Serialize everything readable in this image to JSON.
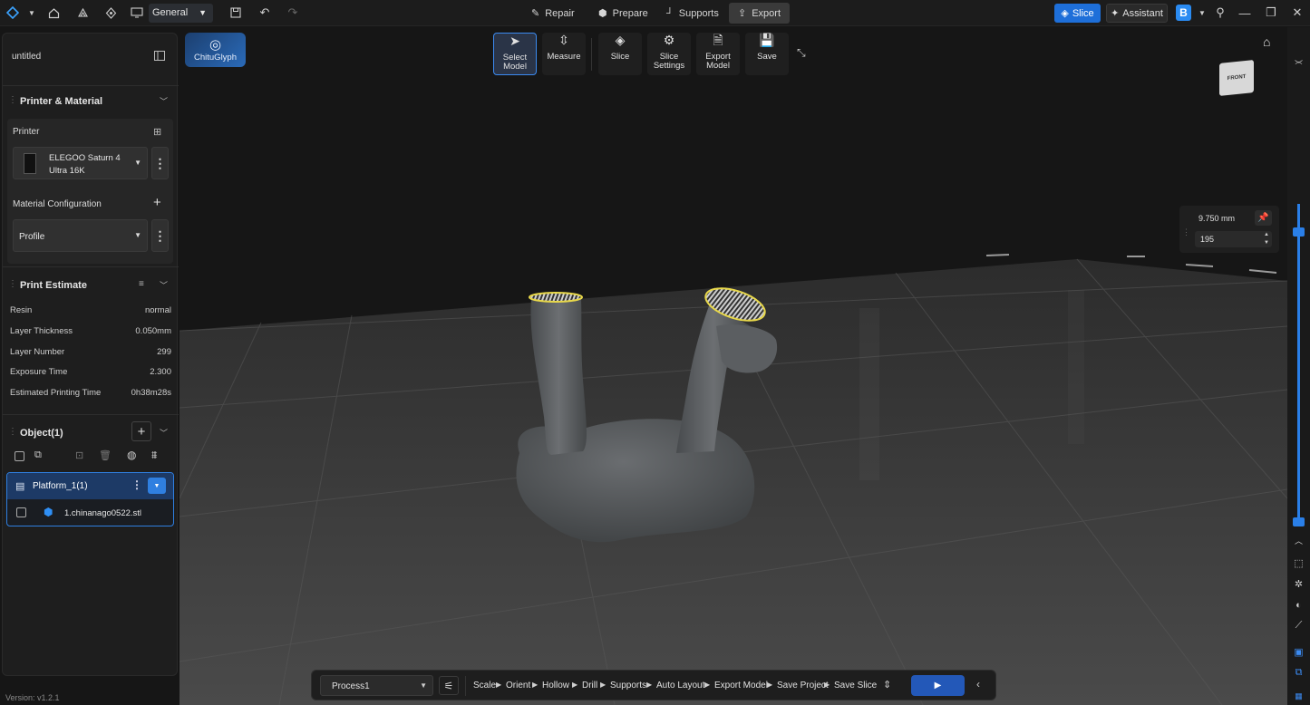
{
  "topbar": {
    "workspace": "General",
    "modes": [
      {
        "label": "Repair",
        "icon": "repair-icon"
      },
      {
        "label": "Prepare",
        "icon": "prepare-icon"
      },
      {
        "label": "Supports",
        "icon": "supports-icon"
      },
      {
        "label": "Export",
        "icon": "export-icon",
        "active": true
      }
    ],
    "slice_label": "Slice",
    "assistant_label": "Assistant",
    "profile_letter": "B"
  },
  "left_panel": {
    "project_name": "untitled",
    "printer_material": {
      "title": "Printer & Material",
      "printer_label": "Printer",
      "printer_name": "ELEGOO Saturn 4 Ultra 16K",
      "material_label": "Material Configuration",
      "profile": "Profile"
    },
    "print_estimate": {
      "title": "Print Estimate",
      "rows": [
        {
          "label": "Resin",
          "value": "normal"
        },
        {
          "label": "Layer Thickness",
          "value": "0.050mm"
        },
        {
          "label": "Layer Number",
          "value": "299"
        },
        {
          "label": "Exposure Time",
          "value": "2.300"
        },
        {
          "label": "Estimated Printing Time",
          "value": "0h38m28s"
        }
      ]
    },
    "objects": {
      "title": "Object(1)",
      "platform": "Platform_1(1)",
      "file": "1.chinanago0522.stl"
    },
    "version": "Version: v1.2.1"
  },
  "viewport": {
    "chitu_label": "ChituGlyph",
    "tools": [
      {
        "label": "Select Model",
        "active": true
      },
      {
        "label": "Measure"
      },
      {
        "label": "Slice"
      },
      {
        "label": "Slice Settings"
      },
      {
        "label": "Export Model"
      },
      {
        "label": "Save"
      }
    ],
    "cube_face": "FRONT",
    "layer_height": "9.750 mm",
    "layer_index": "195"
  },
  "process_bar": {
    "process": "Process1",
    "steps": [
      "Scale",
      "Orient",
      "Hollow",
      "Drill",
      "Supports",
      "Auto Layout",
      "Export Model",
      "Save Project",
      "Save Slice"
    ]
  },
  "colors": {
    "accent": "#1e6fd9",
    "model": "#5a5d60",
    "highlight": "#e8d84a"
  }
}
